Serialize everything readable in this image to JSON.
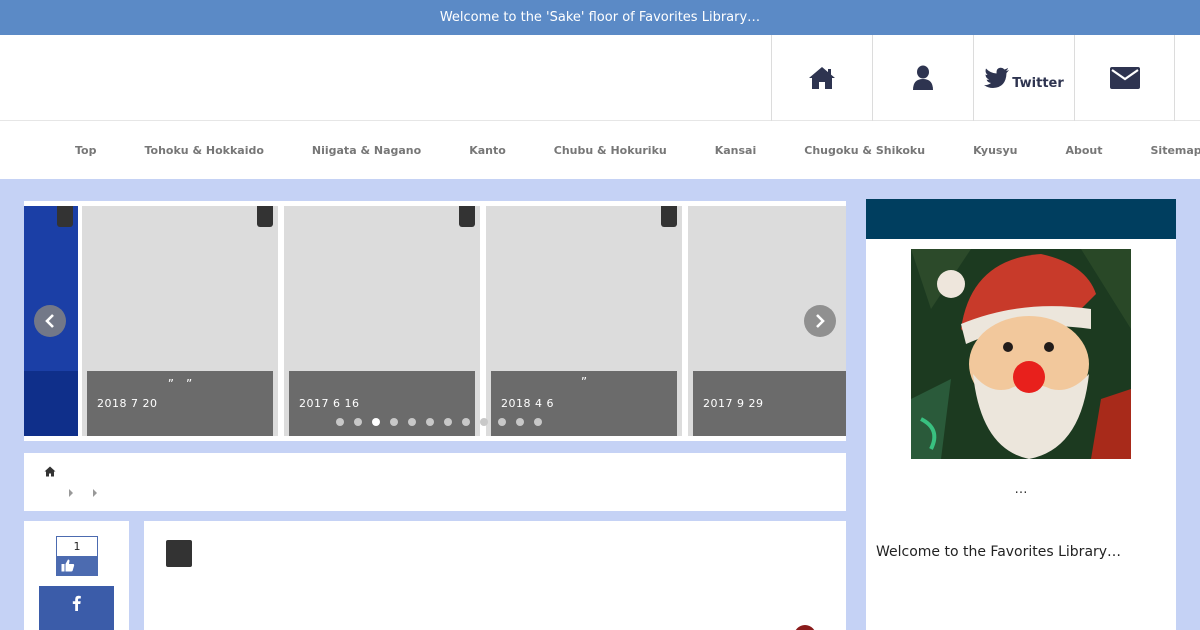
{
  "topbar": {
    "text": "Welcome to the 'Sake' floor of Favorites Library…"
  },
  "header_nav": {
    "twitter_label": "Twitter"
  },
  "global_nav": {
    "items": [
      "Top",
      "Tohoku & Hokkaido",
      "Niigata & Nagano",
      "Kanto",
      "Chubu & Hokuriku",
      "Kansai",
      "Chugoku & Shikoku",
      "Kyusyu",
      "About",
      "Sitemap"
    ]
  },
  "slider": {
    "slides": [
      {
        "title": "",
        "date": ""
      },
      {
        "title": "”　”",
        "date": "2018  7  20"
      },
      {
        "title": "",
        "date": "2017  6  16"
      },
      {
        "title": "”",
        "date": "2018  4  6"
      },
      {
        "title": "",
        "date": "2017  9  29"
      }
    ],
    "dot_count": 12,
    "active_dot": 2
  },
  "share": {
    "like_count": "1"
  },
  "sidebar": {
    "ellipsis": "…",
    "welcome": "Welcome to the Favorites Library…"
  },
  "colors": {
    "topbar": "#5b8ac6",
    "background": "#c5d2f5",
    "sidebar_header": "#003e5f",
    "facebook": "#3b5ca9",
    "icon": "#2e3450"
  }
}
